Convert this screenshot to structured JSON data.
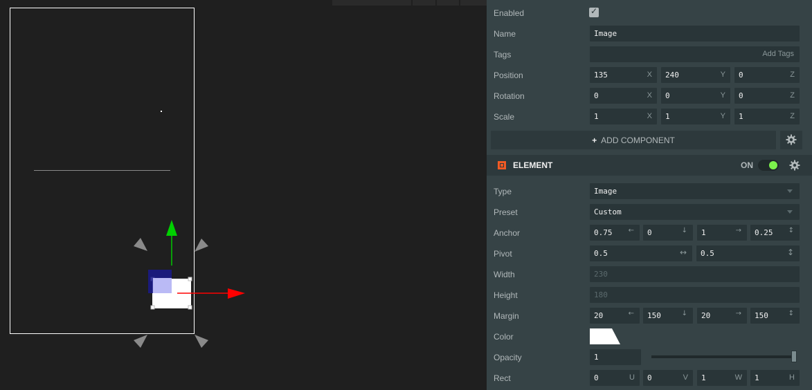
{
  "inspector": {
    "enabled": {
      "label": "Enabled",
      "checked": true
    },
    "name": {
      "label": "Name",
      "value": "Image"
    },
    "tags": {
      "label": "Tags",
      "placeholder": "Add Tags"
    },
    "position": {
      "label": "Position",
      "x": "135",
      "y": "240",
      "z": "0"
    },
    "rotation": {
      "label": "Rotation",
      "x": "0",
      "y": "0",
      "z": "0"
    },
    "scale": {
      "label": "Scale",
      "x": "1",
      "y": "1",
      "z": "1"
    },
    "add_component": {
      "plus": "+",
      "label": "ADD COMPONENT"
    },
    "axis": {
      "x": "X",
      "y": "Y",
      "z": "Z"
    }
  },
  "element": {
    "title": "ELEMENT",
    "toggle_label": "ON",
    "enabled": true,
    "type": {
      "label": "Type",
      "value": "Image"
    },
    "preset": {
      "label": "Preset",
      "value": "Custom"
    },
    "anchor": {
      "label": "Anchor",
      "values": [
        "0.75",
        "0",
        "1",
        "0.25"
      ]
    },
    "pivot": {
      "label": "Pivot",
      "values": [
        "0.5",
        "0.5"
      ]
    },
    "width": {
      "label": "Width",
      "value": "230"
    },
    "height": {
      "label": "Height",
      "value": "180"
    },
    "margin": {
      "label": "Margin",
      "values": [
        "20",
        "150",
        "20",
        "150"
      ]
    },
    "color": {
      "label": "Color",
      "value": "#ffffff"
    },
    "opacity": {
      "label": "Opacity",
      "value": "1"
    },
    "rect": {
      "label": "Rect",
      "values": [
        "0",
        "0",
        "1",
        "1"
      ],
      "axes": [
        "U",
        "V",
        "W",
        "H"
      ]
    }
  },
  "colors": {
    "accent_orange": "#f15a24",
    "toggle_on": "#7cf24c",
    "gizmo_x": "#ff0000",
    "gizmo_y": "#00c800",
    "gizmo_z": "#1a1a8c"
  },
  "icons": [
    "gear-icon",
    "checkmark-icon",
    "plus-icon",
    "caret-down-icon",
    "element-icon",
    "arrow-left-icon",
    "arrow-down-icon",
    "arrow-right-icon",
    "arrow-horizontal-icon",
    "arrow-vertical-icon"
  ]
}
